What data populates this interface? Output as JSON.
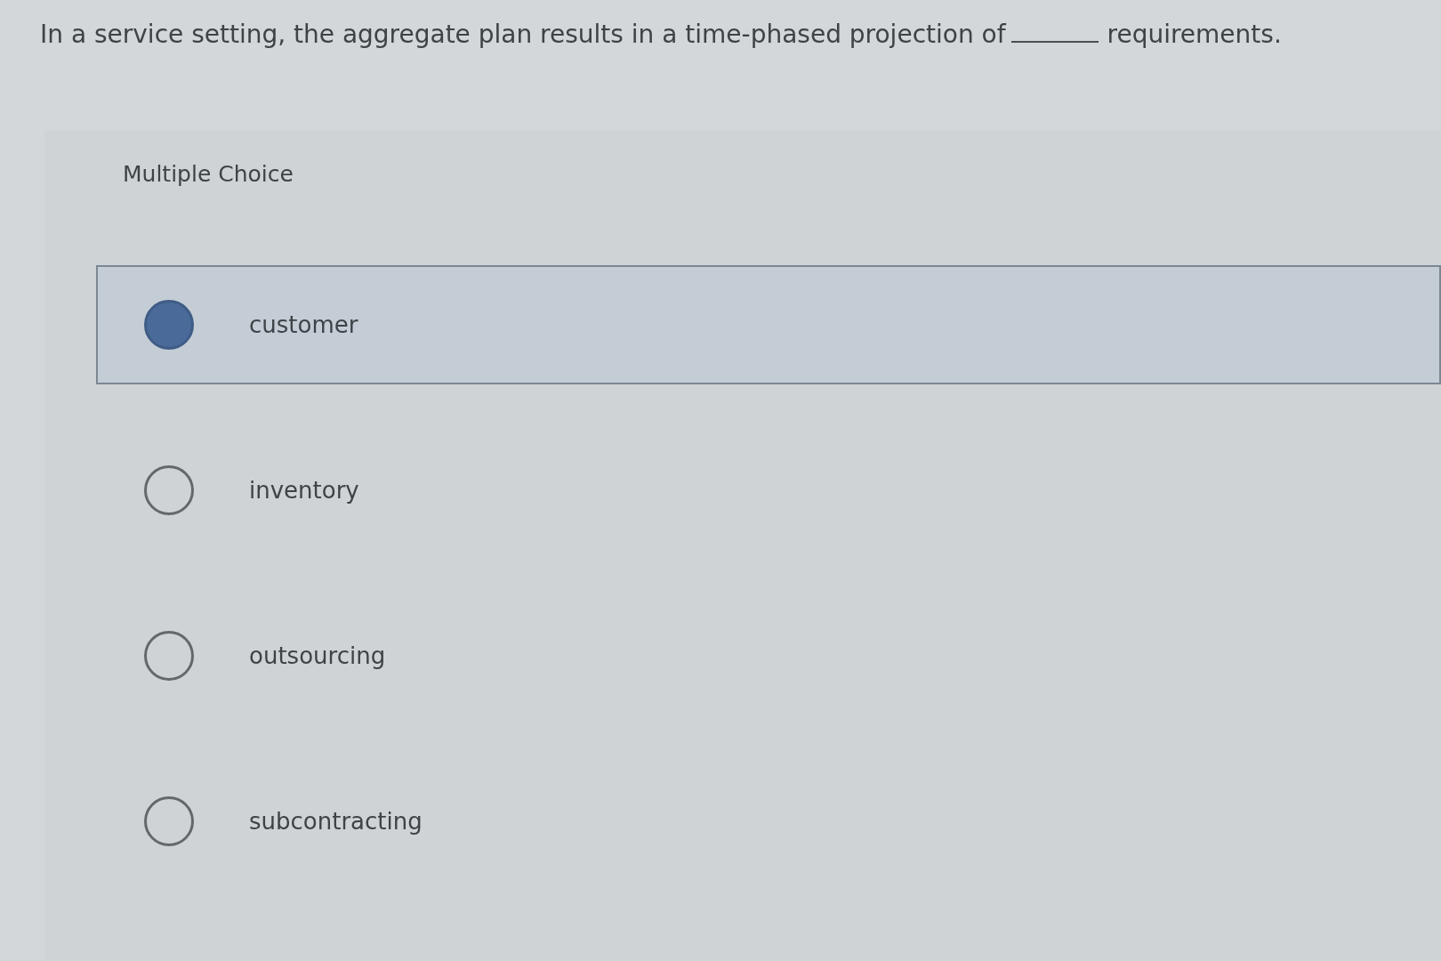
{
  "question": {
    "text_before": "In a service setting, the aggregate plan results in a time-phased projection of",
    "text_after": "requirements."
  },
  "heading": "Multiple Choice",
  "options": [
    {
      "label": "customer",
      "selected": true
    },
    {
      "label": "inventory",
      "selected": false
    },
    {
      "label": "outsourcing",
      "selected": false
    },
    {
      "label": "subcontracting",
      "selected": false
    }
  ]
}
